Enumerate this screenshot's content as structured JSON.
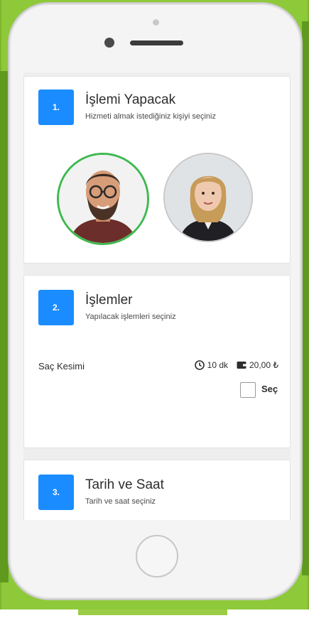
{
  "steps": [
    {
      "number": "1.",
      "title": "İşlemi Yapacak",
      "subtitle": "Hizmeti almak istediğiniz kişiyi seçiniz",
      "staff": [
        {
          "selected": true
        },
        {
          "selected": false
        }
      ]
    },
    {
      "number": "2.",
      "title": "İşlemler",
      "subtitle": "Yapılacak işlemleri seçiniz",
      "service": {
        "name": "Saç Kesimi",
        "duration": "10 dk",
        "price": "20,00 ₺",
        "select_label": "Seç"
      }
    },
    {
      "number": "3.",
      "title": "Tarih ve Saat",
      "subtitle": "Tarih ve saat seçiniz"
    }
  ],
  "colors": {
    "badge": "#1a8cff",
    "selected_ring": "#3fb950",
    "frame_green": "#8ec93a"
  },
  "icons": {
    "duration": "clock-icon",
    "price": "wallet-icon"
  }
}
